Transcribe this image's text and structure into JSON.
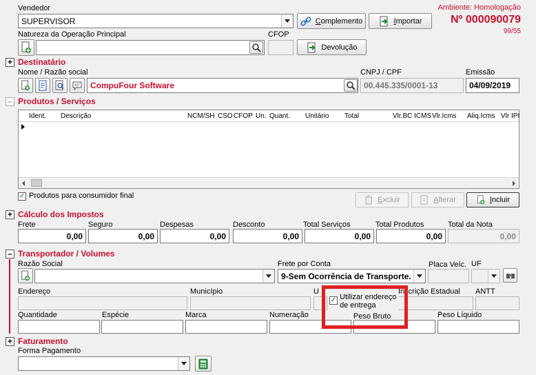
{
  "header": {
    "environment": "Ambiente: Homologação",
    "number": "Nº 000090079",
    "serie": "99/55"
  },
  "vendedor": {
    "label": "Vendedor",
    "value": "SUPERVISOR"
  },
  "buttons": {
    "complemento": "Complemento",
    "importar": "Importar",
    "devolucao": "Devolução",
    "excluir": "Excluir",
    "alterar": "Alterar",
    "incluir": "Incluir"
  },
  "natureza": {
    "label": "Natureza da Operação Principal",
    "value": ""
  },
  "cfop": {
    "label": "CFOP",
    "value": ""
  },
  "destinatario": {
    "title": "Destinatário",
    "name_label": "Nome / Razão social",
    "name_value": "CompuFour Software",
    "cnpj_label": "CNPJ / CPF",
    "cnpj_value": "00.445.335/0001-13",
    "emissao_label": "Emissão",
    "emissao_value": "04/09/2019"
  },
  "produtos": {
    "title": "Produtos / Serviços",
    "columns": [
      "Ident.",
      "Descrição",
      "NCM/SH",
      "CSO",
      "CFOP",
      "Un.",
      "Quant.",
      "Unitário",
      "Total",
      "Vlr.BC ICMS",
      "Vlr.Icms",
      "Aliq.Icms",
      "Vlr IPI"
    ],
    "consumidor_final": "Produtos para consumidor final"
  },
  "impostos": {
    "title": "Cálculo dos Impostos",
    "fields": [
      {
        "label": "Frete",
        "value": "0,00"
      },
      {
        "label": "Seguro",
        "value": "0,00"
      },
      {
        "label": "Despesas",
        "value": "0,00"
      },
      {
        "label": "Desconto",
        "value": "0,00"
      },
      {
        "label": "Total Serviços",
        "value": "0,00"
      },
      {
        "label": "Total Produtos",
        "value": "0,00"
      },
      {
        "label": "Total da Nota",
        "value": "0,00"
      }
    ]
  },
  "transportador": {
    "title": "Transportador / Volumes",
    "razao_label": "Razão Social",
    "frete_label": "Frete por Conta",
    "frete_value": "9-Sem Ocorrência de Transporte.",
    "placa_label": "Placa Veíc.",
    "uf_label": "UF",
    "endereco_label": "Endereço",
    "municipio_label": "Município",
    "uf2_label": "U",
    "ie_label": "Inscrição Estadual",
    "antt_label": "ANTT",
    "utilizar_endereco": "Utilizar endereço de entrega",
    "quantidade_label": "Quantidade",
    "especie_label": "Espécie",
    "marca_label": "Marca",
    "numeracao_label": "Numeração",
    "peso_bruto_label": "Peso Bruto",
    "peso_liquido_label": "Peso Líquido"
  },
  "faturamento": {
    "title": "Faturamento",
    "forma_label": "Forma Pagamento",
    "forma_value": ""
  },
  "colors": {
    "accent": "#c8102e",
    "highlight": "#e02020"
  }
}
